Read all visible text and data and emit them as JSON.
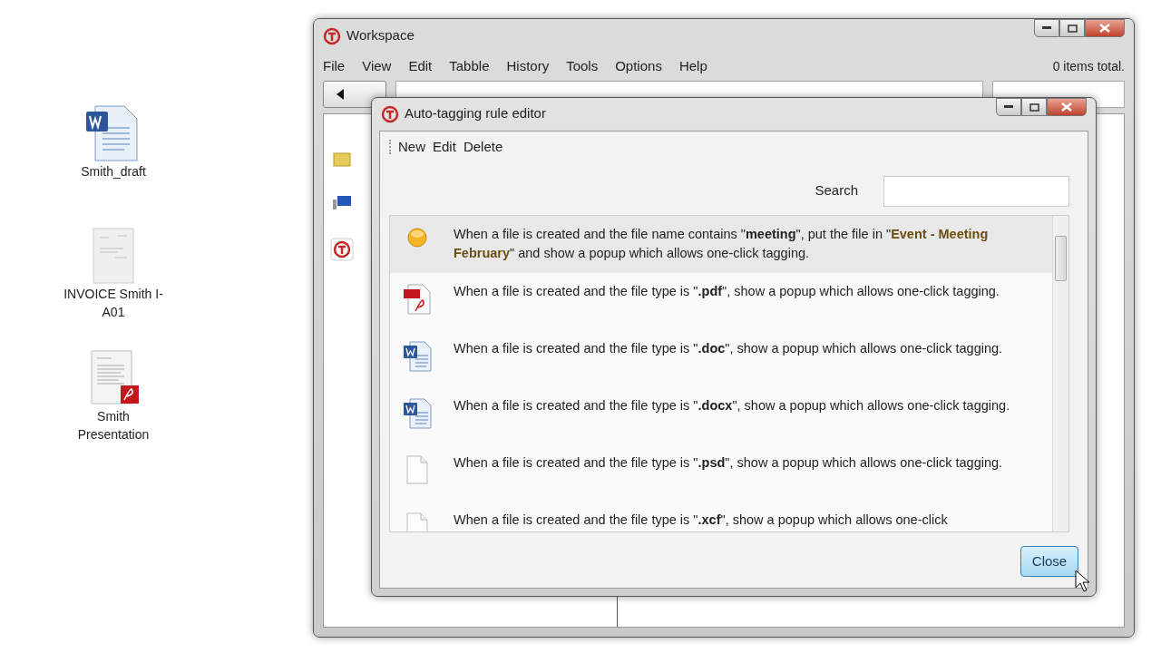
{
  "desktop_icons": [
    {
      "kind": "word",
      "label": "Smith_draft"
    },
    {
      "kind": "invoice",
      "label": "INVOICE Smith I-A01"
    },
    {
      "kind": "pdf",
      "label": "Smith Presentation"
    }
  ],
  "main_window": {
    "title": "Workspace",
    "menu": [
      "File",
      "View",
      "Edit",
      "Tabble",
      "History",
      "Tools",
      "Options",
      "Help"
    ],
    "status": "0 items total."
  },
  "dialog": {
    "title": "Auto-tagging rule editor",
    "toolbar": [
      "New",
      "Edit",
      "Delete"
    ],
    "search": {
      "label": "Search"
    },
    "rules": [
      {
        "kind": "meeting",
        "selected": true,
        "text": "When a file is created  and the file name contains \"**meeting**\", put the file in  \"**Event - Meeting February**\" and show a popup which allows one-click tagging."
      },
      {
        "kind": "pdf",
        "selected": false,
        "text": "When a file is created  and the file type is \"**.pdf**\", show a popup which allows one-click tagging."
      },
      {
        "kind": "doc",
        "selected": false,
        "text": "When a file is created  and the file type is \"**.doc**\", show a popup which allows one-click tagging."
      },
      {
        "kind": "docx",
        "selected": false,
        "text": "When a file is created  and the file type is \"**.docx**\", show a popup which allows one-click tagging."
      },
      {
        "kind": "blank",
        "selected": false,
        "text": "When a file is created  and the file type is \"**.psd**\", show a popup which allows one-click tagging."
      },
      {
        "kind": "blank",
        "selected": false,
        "text": "When a file is created  and the file type is \"**.xcf**\", show a popup which allows one-click"
      }
    ],
    "close_button": "Close"
  }
}
